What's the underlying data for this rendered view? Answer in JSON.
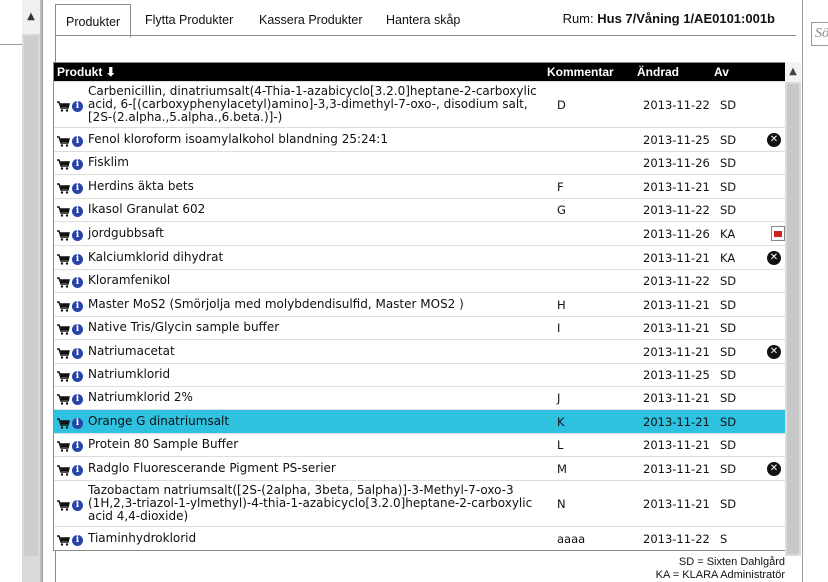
{
  "tabs": [
    {
      "label": "Produkter",
      "active": true
    },
    {
      "label": "Flytta Produkter",
      "active": false
    },
    {
      "label": "Kassera Produkter",
      "active": false
    },
    {
      "label": "Hantera skåp",
      "active": false
    }
  ],
  "room": {
    "label": "Rum:",
    "value": "Hus 7/Våning 1/AE0101:001b"
  },
  "table": {
    "headers": {
      "product": "Produkt",
      "sort_icon": "arrow-down",
      "comment": "Kommentar",
      "changed": "Ändrad",
      "by": "Av"
    },
    "rows": [
      {
        "name": "Carbenicillin, dinatriumsalt(4-Thia-1-azabicyclo[3.2.0]heptane-2-carboxylic acid, 6-[(carboxyphenylacetyl)amino]-3,3-dimethyl-7-oxo-, disodium salt, [2S-(2.alpha.,5.alpha.,6.beta.)]-)",
        "comment": "D",
        "date": "2013-11-22",
        "by": "SD",
        "action": ""
      },
      {
        "name": "Fenol kloroform isoamylalkohol blandning 25:24:1",
        "comment": "",
        "date": "2013-11-25",
        "by": "SD",
        "action": "remove"
      },
      {
        "name": "Fisklim",
        "comment": "",
        "date": "2013-11-26",
        "by": "SD",
        "action": ""
      },
      {
        "name": "Herdins äkta bets",
        "comment": "F",
        "date": "2013-11-21",
        "by": "SD",
        "action": ""
      },
      {
        "name": "Ikasol Granulat 602",
        "comment": "G",
        "date": "2013-11-22",
        "by": "SD",
        "action": ""
      },
      {
        "name": "jordgubbsaft",
        "comment": "",
        "date": "2013-11-26",
        "by": "KA",
        "action": "pdf"
      },
      {
        "name": "Kalciumklorid dihydrat",
        "comment": "",
        "date": "2013-11-21",
        "by": "KA",
        "action": "remove"
      },
      {
        "name": "Kloramfenikol",
        "comment": "",
        "date": "2013-11-22",
        "by": "SD",
        "action": ""
      },
      {
        "name": "Master MoS2 (Smörjolja med molybdendisulfid, Master MOS2 )",
        "comment": "H",
        "date": "2013-11-21",
        "by": "SD",
        "action": ""
      },
      {
        "name": "Native Tris/Glycin sample buffer",
        "comment": "I",
        "date": "2013-11-21",
        "by": "SD",
        "action": ""
      },
      {
        "name": "Natriumacetat",
        "comment": "",
        "date": "2013-11-21",
        "by": "SD",
        "action": "remove"
      },
      {
        "name": "Natriumklorid",
        "comment": "",
        "date": "2013-11-25",
        "by": "SD",
        "action": ""
      },
      {
        "name": "Natriumklorid 2%",
        "comment": "J",
        "date": "2013-11-21",
        "by": "SD",
        "action": ""
      },
      {
        "name": "Orange G dinatriumsalt",
        "comment": "K",
        "date": "2013-11-21",
        "by": "SD",
        "action": "",
        "selected": true
      },
      {
        "name": "Protein 80 Sample Buffer",
        "comment": "L",
        "date": "2013-11-21",
        "by": "SD",
        "action": ""
      },
      {
        "name": "Radglo Fluorescerande Pigment PS-serier",
        "comment": "M",
        "date": "2013-11-21",
        "by": "SD",
        "action": "remove"
      },
      {
        "name": "Tazobactam natriumsalt([2S-(2alpha, 3beta, 5alpha)]-3-Methyl-7-oxo-3 (1H,2,3-triazol-1-ylmethyl)-4-thia-1-azabicyclo[3.2.0]heptane-2-carboxylic acid 4,4-dioxide)",
        "comment": "N",
        "date": "2013-11-21",
        "by": "SD",
        "action": ""
      },
      {
        "name": "Tiaminhydroklorid",
        "comment": "aaaa",
        "date": "2013-11-22",
        "by": "S",
        "action": ""
      }
    ]
  },
  "legend": [
    "SD = Sixten Dahlgård",
    "KA = KLARA Administratör"
  ],
  "search": {
    "placeholder": "Sö"
  },
  "colors": {
    "selected_row": "#2ec1e0",
    "header_bg": "#000000"
  }
}
